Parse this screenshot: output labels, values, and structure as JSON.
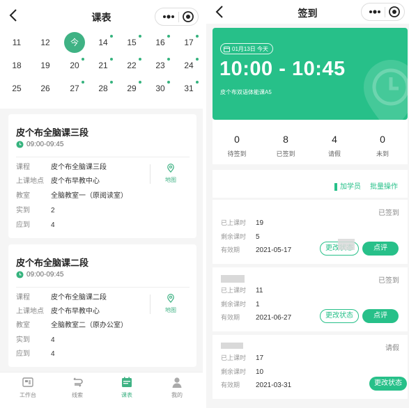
{
  "colors": {
    "accent": "#3fb284",
    "banner": "#27c089"
  },
  "schedule": {
    "title": "课表",
    "calendar": {
      "rows": [
        [
          {
            "label": "11",
            "dot": false
          },
          {
            "label": "12",
            "dot": false
          },
          {
            "label": "今",
            "dot": false,
            "today": true
          },
          {
            "label": "14",
            "dot": true
          },
          {
            "label": "15",
            "dot": true
          },
          {
            "label": "16",
            "dot": true
          },
          {
            "label": "17",
            "dot": true
          }
        ],
        [
          {
            "label": "18",
            "dot": false
          },
          {
            "label": "19",
            "dot": false
          },
          {
            "label": "20",
            "dot": true
          },
          {
            "label": "21",
            "dot": true
          },
          {
            "label": "22",
            "dot": true
          },
          {
            "label": "23",
            "dot": true
          },
          {
            "label": "24",
            "dot": true
          }
        ],
        [
          {
            "label": "25",
            "dot": false
          },
          {
            "label": "26",
            "dot": false
          },
          {
            "label": "27",
            "dot": true
          },
          {
            "label": "28",
            "dot": true
          },
          {
            "label": "29",
            "dot": true
          },
          {
            "label": "30",
            "dot": true
          },
          {
            "label": "31",
            "dot": true
          }
        ]
      ]
    },
    "courses": [
      {
        "name": "皮个布全脑课三段",
        "time": "09:00-09:45",
        "fields": [
          {
            "k": "课程",
            "v": "皮个布全脑课三段"
          },
          {
            "k": "上课地点",
            "v": "皮个布早教中心"
          },
          {
            "k": "教室",
            "v": "全脑教室一（原阅读室）"
          },
          {
            "k": "实到",
            "v": "2"
          },
          {
            "k": "应到",
            "v": "4"
          }
        ],
        "map_label": "地图"
      },
      {
        "name": "皮个布全脑课二段",
        "time": "09:00-09:45",
        "fields": [
          {
            "k": "课程",
            "v": "皮个布全脑课二段"
          },
          {
            "k": "上课地点",
            "v": "皮个布早教中心"
          },
          {
            "k": "教室",
            "v": "全脑教室二（原办公室）"
          },
          {
            "k": "实到",
            "v": "4"
          },
          {
            "k": "应到",
            "v": "4"
          }
        ],
        "map_label": "地图"
      }
    ],
    "tabs": [
      {
        "label": "工作台",
        "icon": "workbench-icon",
        "active": false
      },
      {
        "label": "线索",
        "icon": "leads-icon",
        "active": false
      },
      {
        "label": "课表",
        "icon": "schedule-icon",
        "active": true
      },
      {
        "label": "我的",
        "icon": "person-icon",
        "active": false
      }
    ]
  },
  "checkin": {
    "title": "签到",
    "banner": {
      "date": "01月13日 今天",
      "time": "10:00 - 10:45",
      "course": "皮个布双语体能课A5"
    },
    "stats": [
      {
        "num": "0",
        "label": "待签到"
      },
      {
        "num": "8",
        "label": "已签到"
      },
      {
        "num": "4",
        "label": "请假"
      },
      {
        "num": "0",
        "label": "未到"
      }
    ],
    "ops": {
      "add": "加学员",
      "batch": "批量操作"
    },
    "students": [
      {
        "status": "已签到",
        "fields": [
          {
            "k": "已上课时",
            "v": "19"
          },
          {
            "k": "剩余课时",
            "v": "5"
          },
          {
            "k": "有效期",
            "v": "2021-05-17"
          }
        ],
        "change_label": "更改状态",
        "review_label": "点评"
      },
      {
        "status": "已签到",
        "fields": [
          {
            "k": "已上课时",
            "v": "11"
          },
          {
            "k": "剩余课时",
            "v": "1"
          },
          {
            "k": "有效期",
            "v": "2021-06-27"
          }
        ],
        "change_label": "更改状态",
        "review_label": "点评"
      },
      {
        "status": "请假",
        "fields": [
          {
            "k": "已上课时",
            "v": "17"
          },
          {
            "k": "剩余课时",
            "v": "10"
          },
          {
            "k": "有效期",
            "v": "2021-03-31"
          }
        ],
        "change_label": "更改状态"
      }
    ]
  }
}
